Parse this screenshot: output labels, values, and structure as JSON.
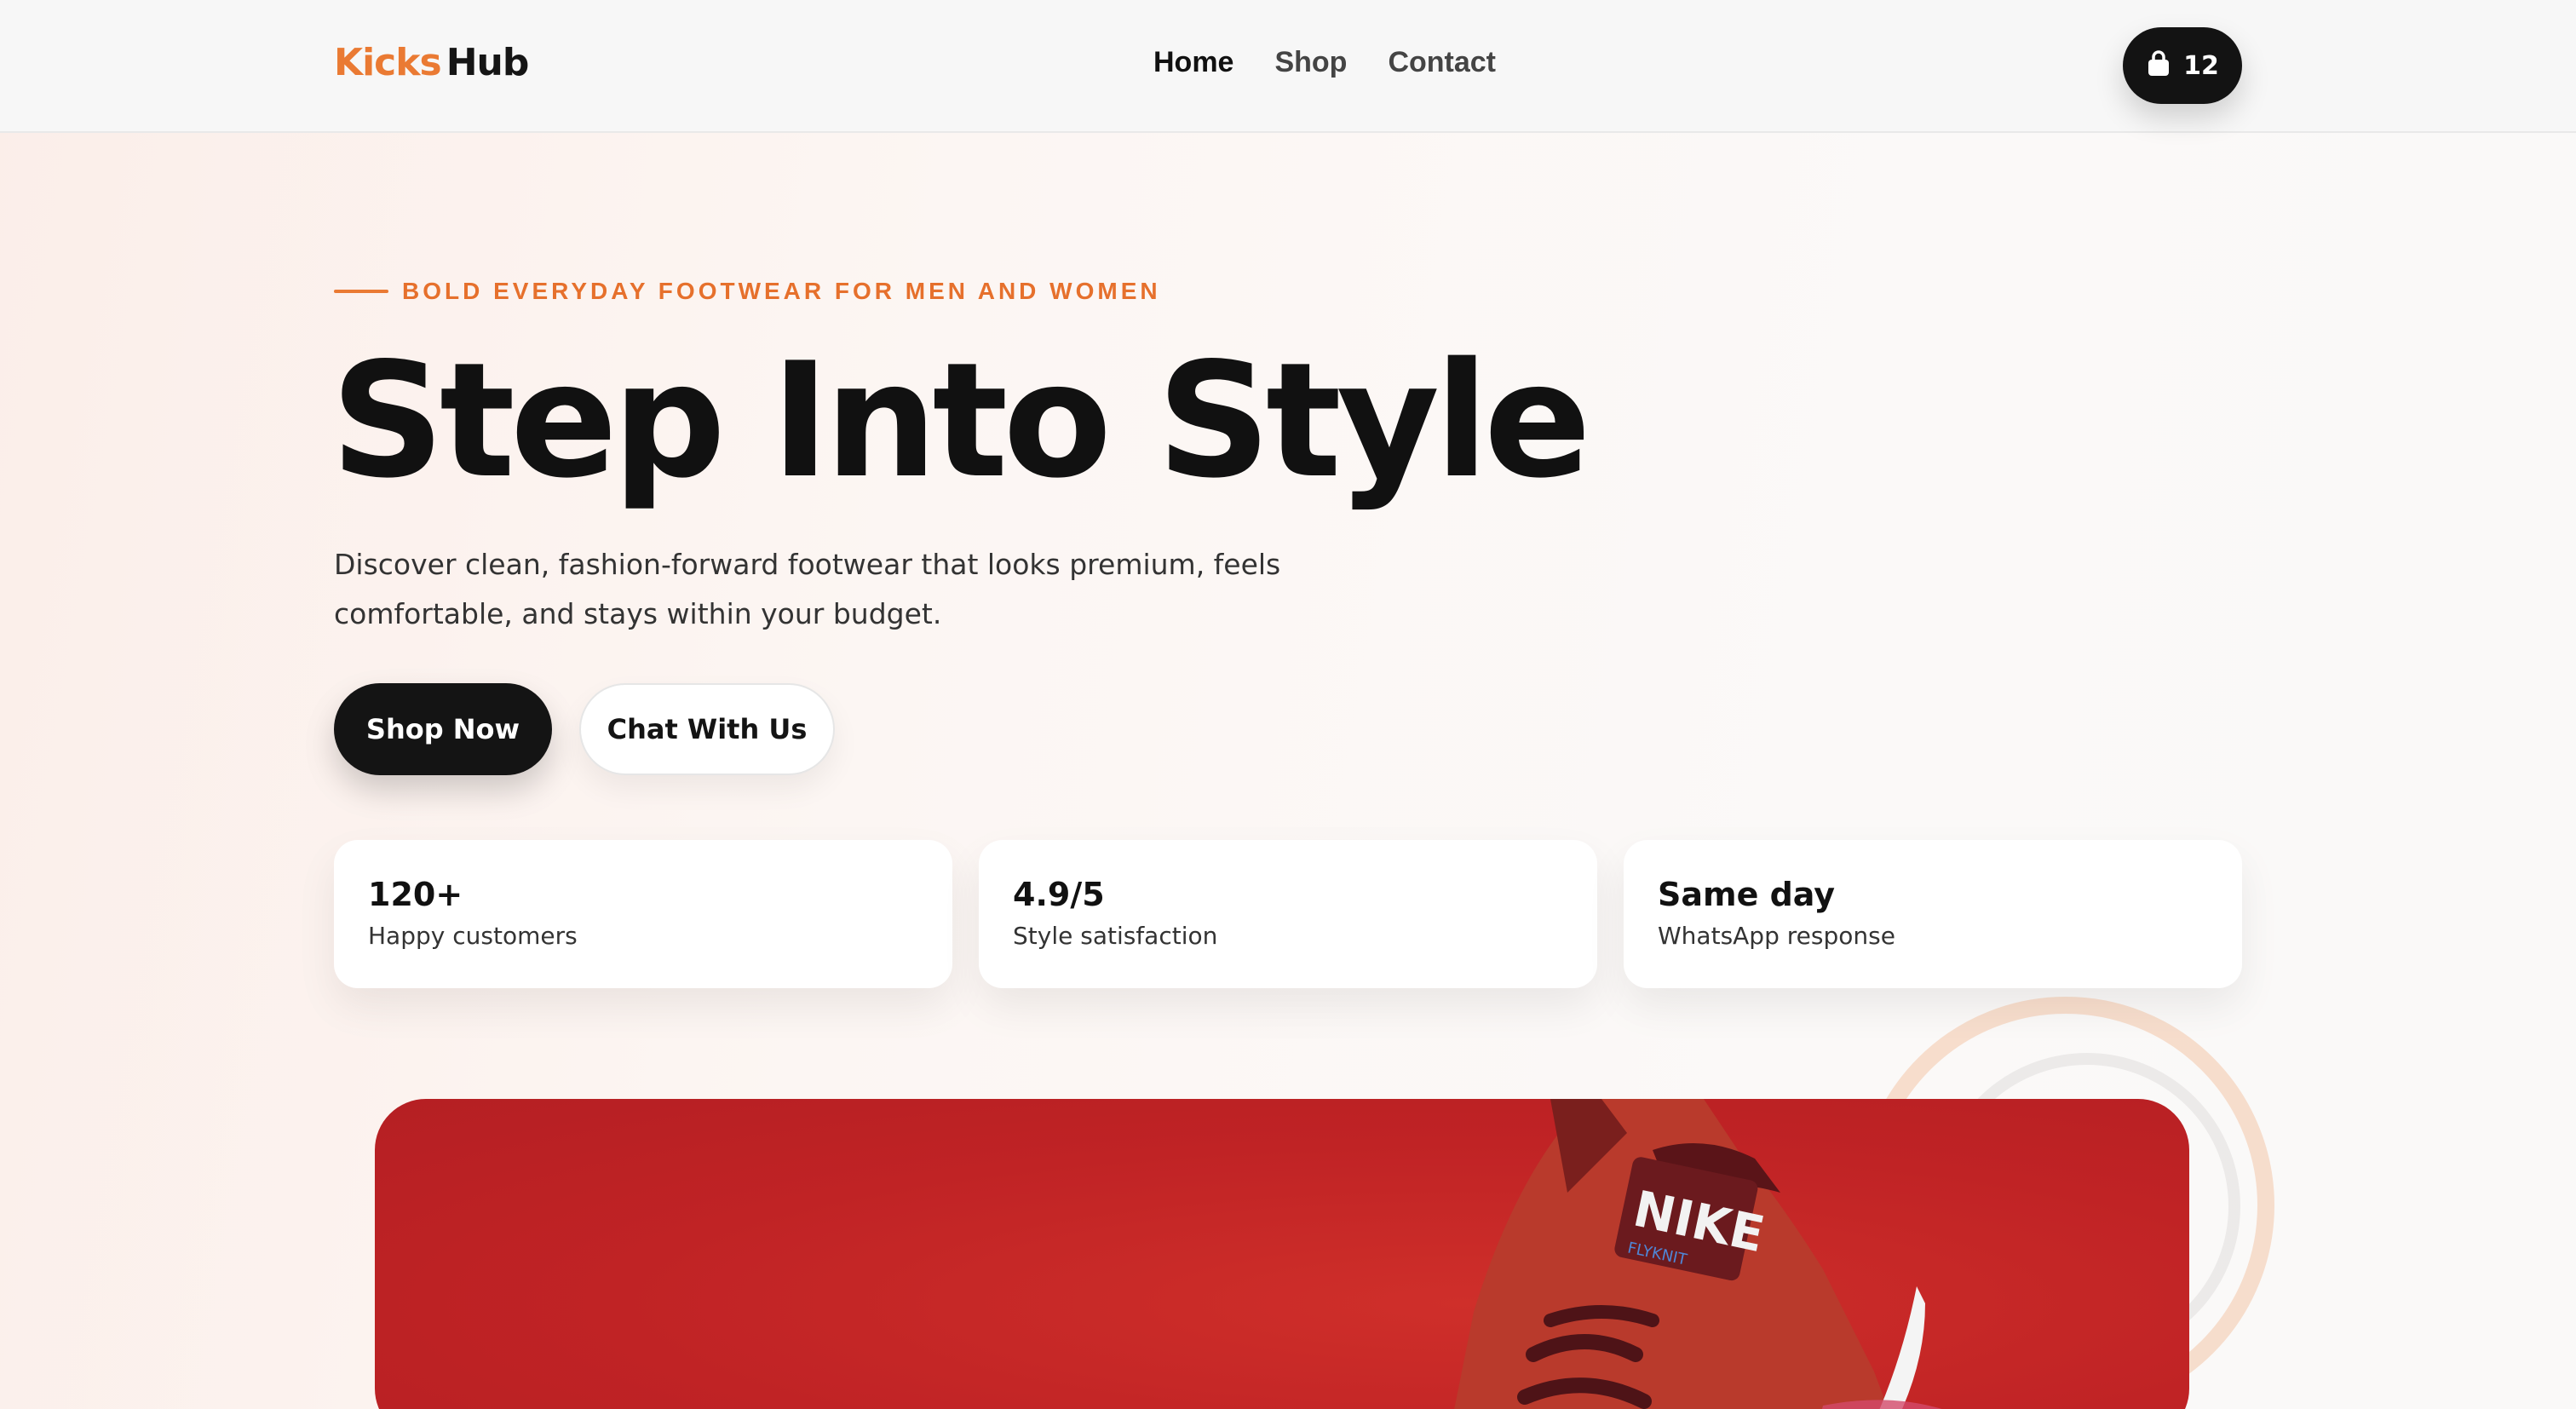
{
  "brand": {
    "part1": "Kicks",
    "part2": "Hub"
  },
  "nav": [
    {
      "label": "Home",
      "active": true
    },
    {
      "label": "Shop",
      "active": false
    },
    {
      "label": "Contact",
      "active": false
    }
  ],
  "cart": {
    "icon": "shopping-bag-icon",
    "count": "12"
  },
  "hero": {
    "eyebrow": "BOLD EVERYDAY FOOTWEAR FOR MEN AND WOMEN",
    "title": "Step Into Style",
    "description": "Discover clean, fashion-forward footwear that looks premium, feels comfortable, and stays within your budget.",
    "primary_button": "Shop Now",
    "secondary_button": "Chat With Us"
  },
  "stats": [
    {
      "value": "120+",
      "label": "Happy customers"
    },
    {
      "value": "4.9/5",
      "label": "Style satisfaction"
    },
    {
      "value": "Same day",
      "label": "WhatsApp response"
    }
  ],
  "product_image": {
    "brand_text": "NIKE",
    "sub_text": "FLYKNIT"
  },
  "colors": {
    "accent": "#ea7a33",
    "dark": "#131313",
    "product_bg": "#c02325"
  }
}
